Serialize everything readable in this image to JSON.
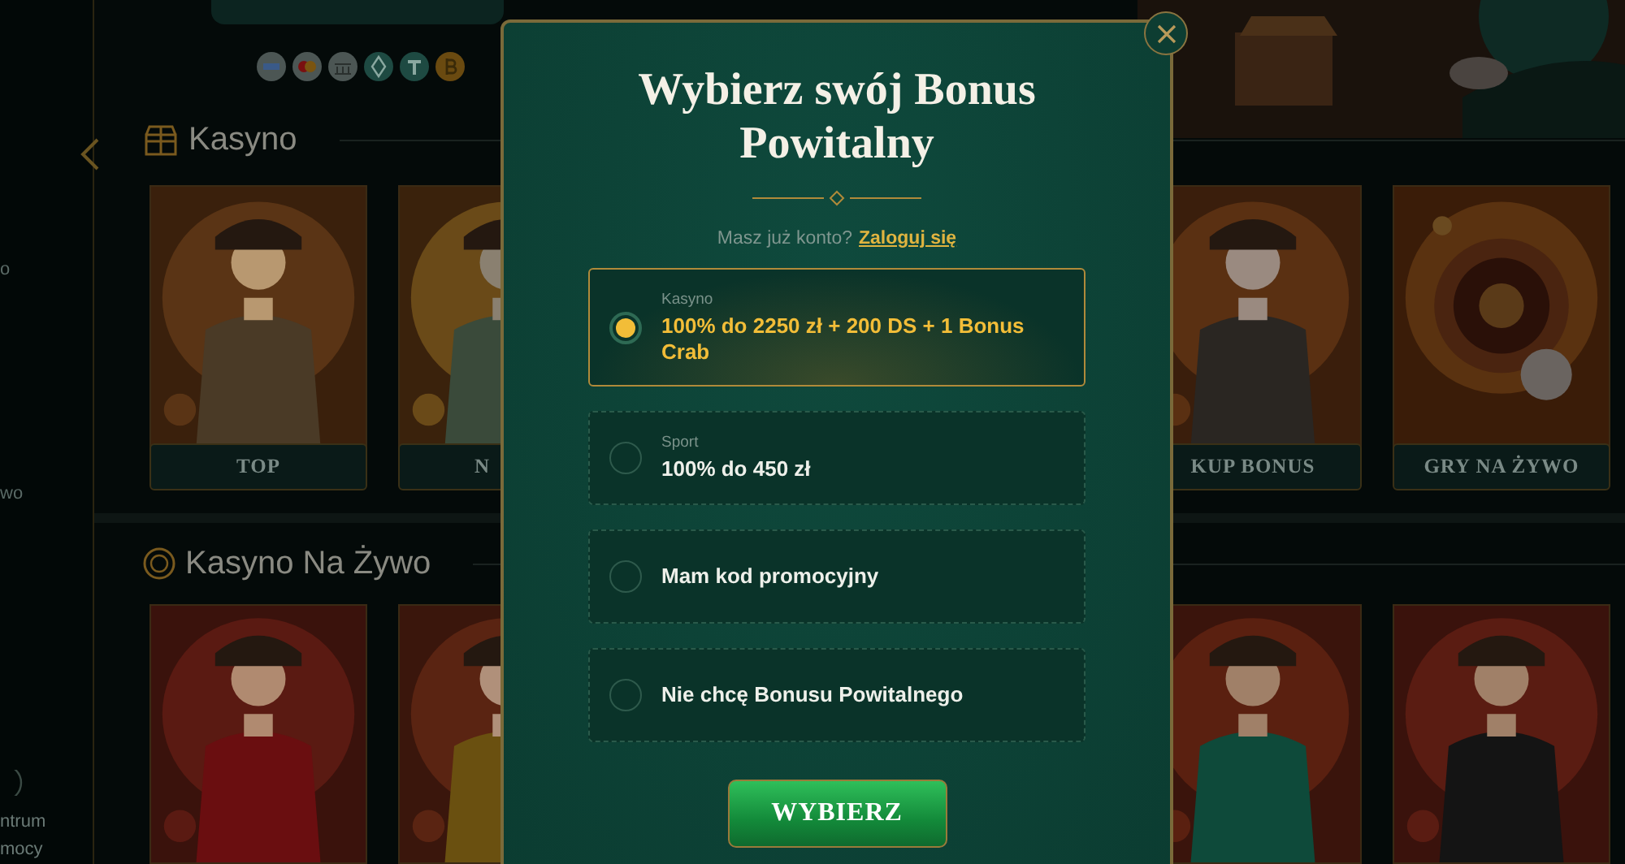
{
  "sidebar": {
    "items": [
      {
        "label": "o"
      },
      {
        "label": "wo"
      }
    ],
    "help_lines": [
      "ntrum",
      "mocy"
    ]
  },
  "sections": [
    {
      "title": "Kasyno",
      "cards": [
        {
          "kind": "picture",
          "label": "TOP"
        },
        {
          "kind": "picture",
          "label": "N"
        },
        {
          "kind": "picture",
          "label": "KUP BONUS"
        },
        {
          "kind": "picture",
          "label": "GRY NA ŻYWO"
        }
      ]
    },
    {
      "title": "Kasyno Na Żywo"
    }
  ],
  "modal": {
    "title": "Wybierz swój Bonus Powitalny",
    "login_prompt": "Masz już konto?",
    "login_link": "Zaloguj się",
    "options": [
      {
        "category": "Kasyno",
        "title": "100% do 2250 zł + 200 DS + 1 Bonus Crab",
        "selected": true
      },
      {
        "category": "Sport",
        "title": "100% do 450 zł",
        "selected": false
      },
      {
        "title": "Mam kod promocyjny",
        "selected": false
      },
      {
        "title": "Nie chcę Bonusu Powitalnego",
        "selected": false
      }
    ],
    "submit": "WYBIERZ"
  }
}
